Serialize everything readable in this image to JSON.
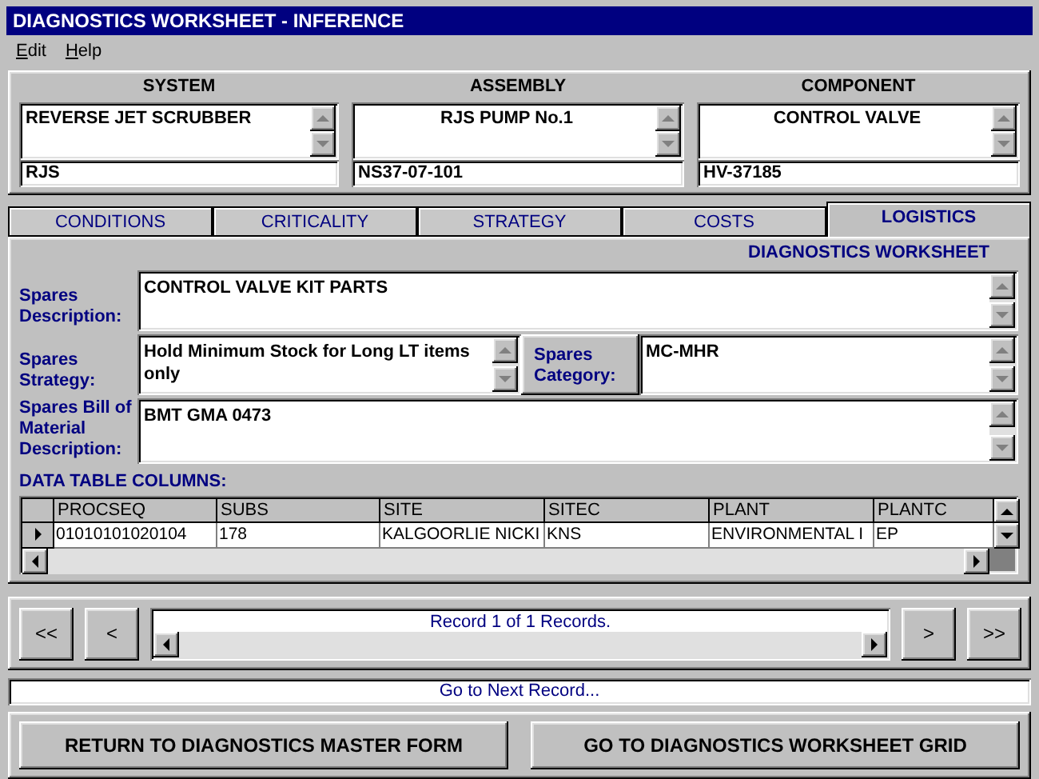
{
  "window": {
    "title": "DIAGNOSTICS WORKSHEET - INFERENCE"
  },
  "menu": [
    "Edit",
    "Help"
  ],
  "header": [
    {
      "heading": "SYSTEM",
      "name": "REVERSE JET SCRUBBER",
      "code": "RJS",
      "centered": false
    },
    {
      "heading": "ASSEMBLY",
      "name": "RJS PUMP No.1",
      "code": "NS37-07-101",
      "centered": true
    },
    {
      "heading": "COMPONENT",
      "name": "CONTROL VALVE",
      "code": "HV-37185",
      "centered": true
    }
  ],
  "tabs": [
    {
      "label": "CONDITIONS",
      "selected": false
    },
    {
      "label": "CRITICALITY",
      "selected": false
    },
    {
      "label": "STRATEGY",
      "selected": false
    },
    {
      "label": "COSTS",
      "selected": false
    },
    {
      "label": "LOGISTICS",
      "selected": true
    }
  ],
  "panel": {
    "heading": "DIAGNOSTICS WORKSHEET",
    "spares_description": {
      "label": "Spares Description:",
      "value": "CONTROL VALVE KIT PARTS"
    },
    "spares_strategy": {
      "label": "Spares Strategy:",
      "value": "Hold Minimum Stock for Long LT items only"
    },
    "spares_category": {
      "label": "Spares Category:",
      "value": "MC-MHR"
    },
    "bill_of_material": {
      "label": "Spares Bill of Material Description:",
      "value": "BMT GMA 0473"
    }
  },
  "table": {
    "label": "DATA TABLE COLUMNS:",
    "columns": [
      "PROCSEQ",
      "SUBS",
      "SITE",
      "SITEC",
      "PLANT",
      "PLANTC"
    ],
    "rows": [
      {
        "current": true,
        "cells": [
          "01010101020104",
          "178",
          "KALGOORLIE NICKI",
          "KNS",
          "ENVIRONMENTAL I",
          "EP"
        ]
      }
    ]
  },
  "navigation": {
    "left_buttons": [
      "<<",
      "<"
    ],
    "record": "Record 1 of 1 Records.",
    "right_buttons": [
      ">",
      ">>"
    ]
  },
  "status": "Go to Next Record...",
  "actions": [
    "RETURN TO DIAGNOSTICS MASTER FORM",
    "GO TO DIAGNOSTICS WORKSHEET GRID"
  ]
}
